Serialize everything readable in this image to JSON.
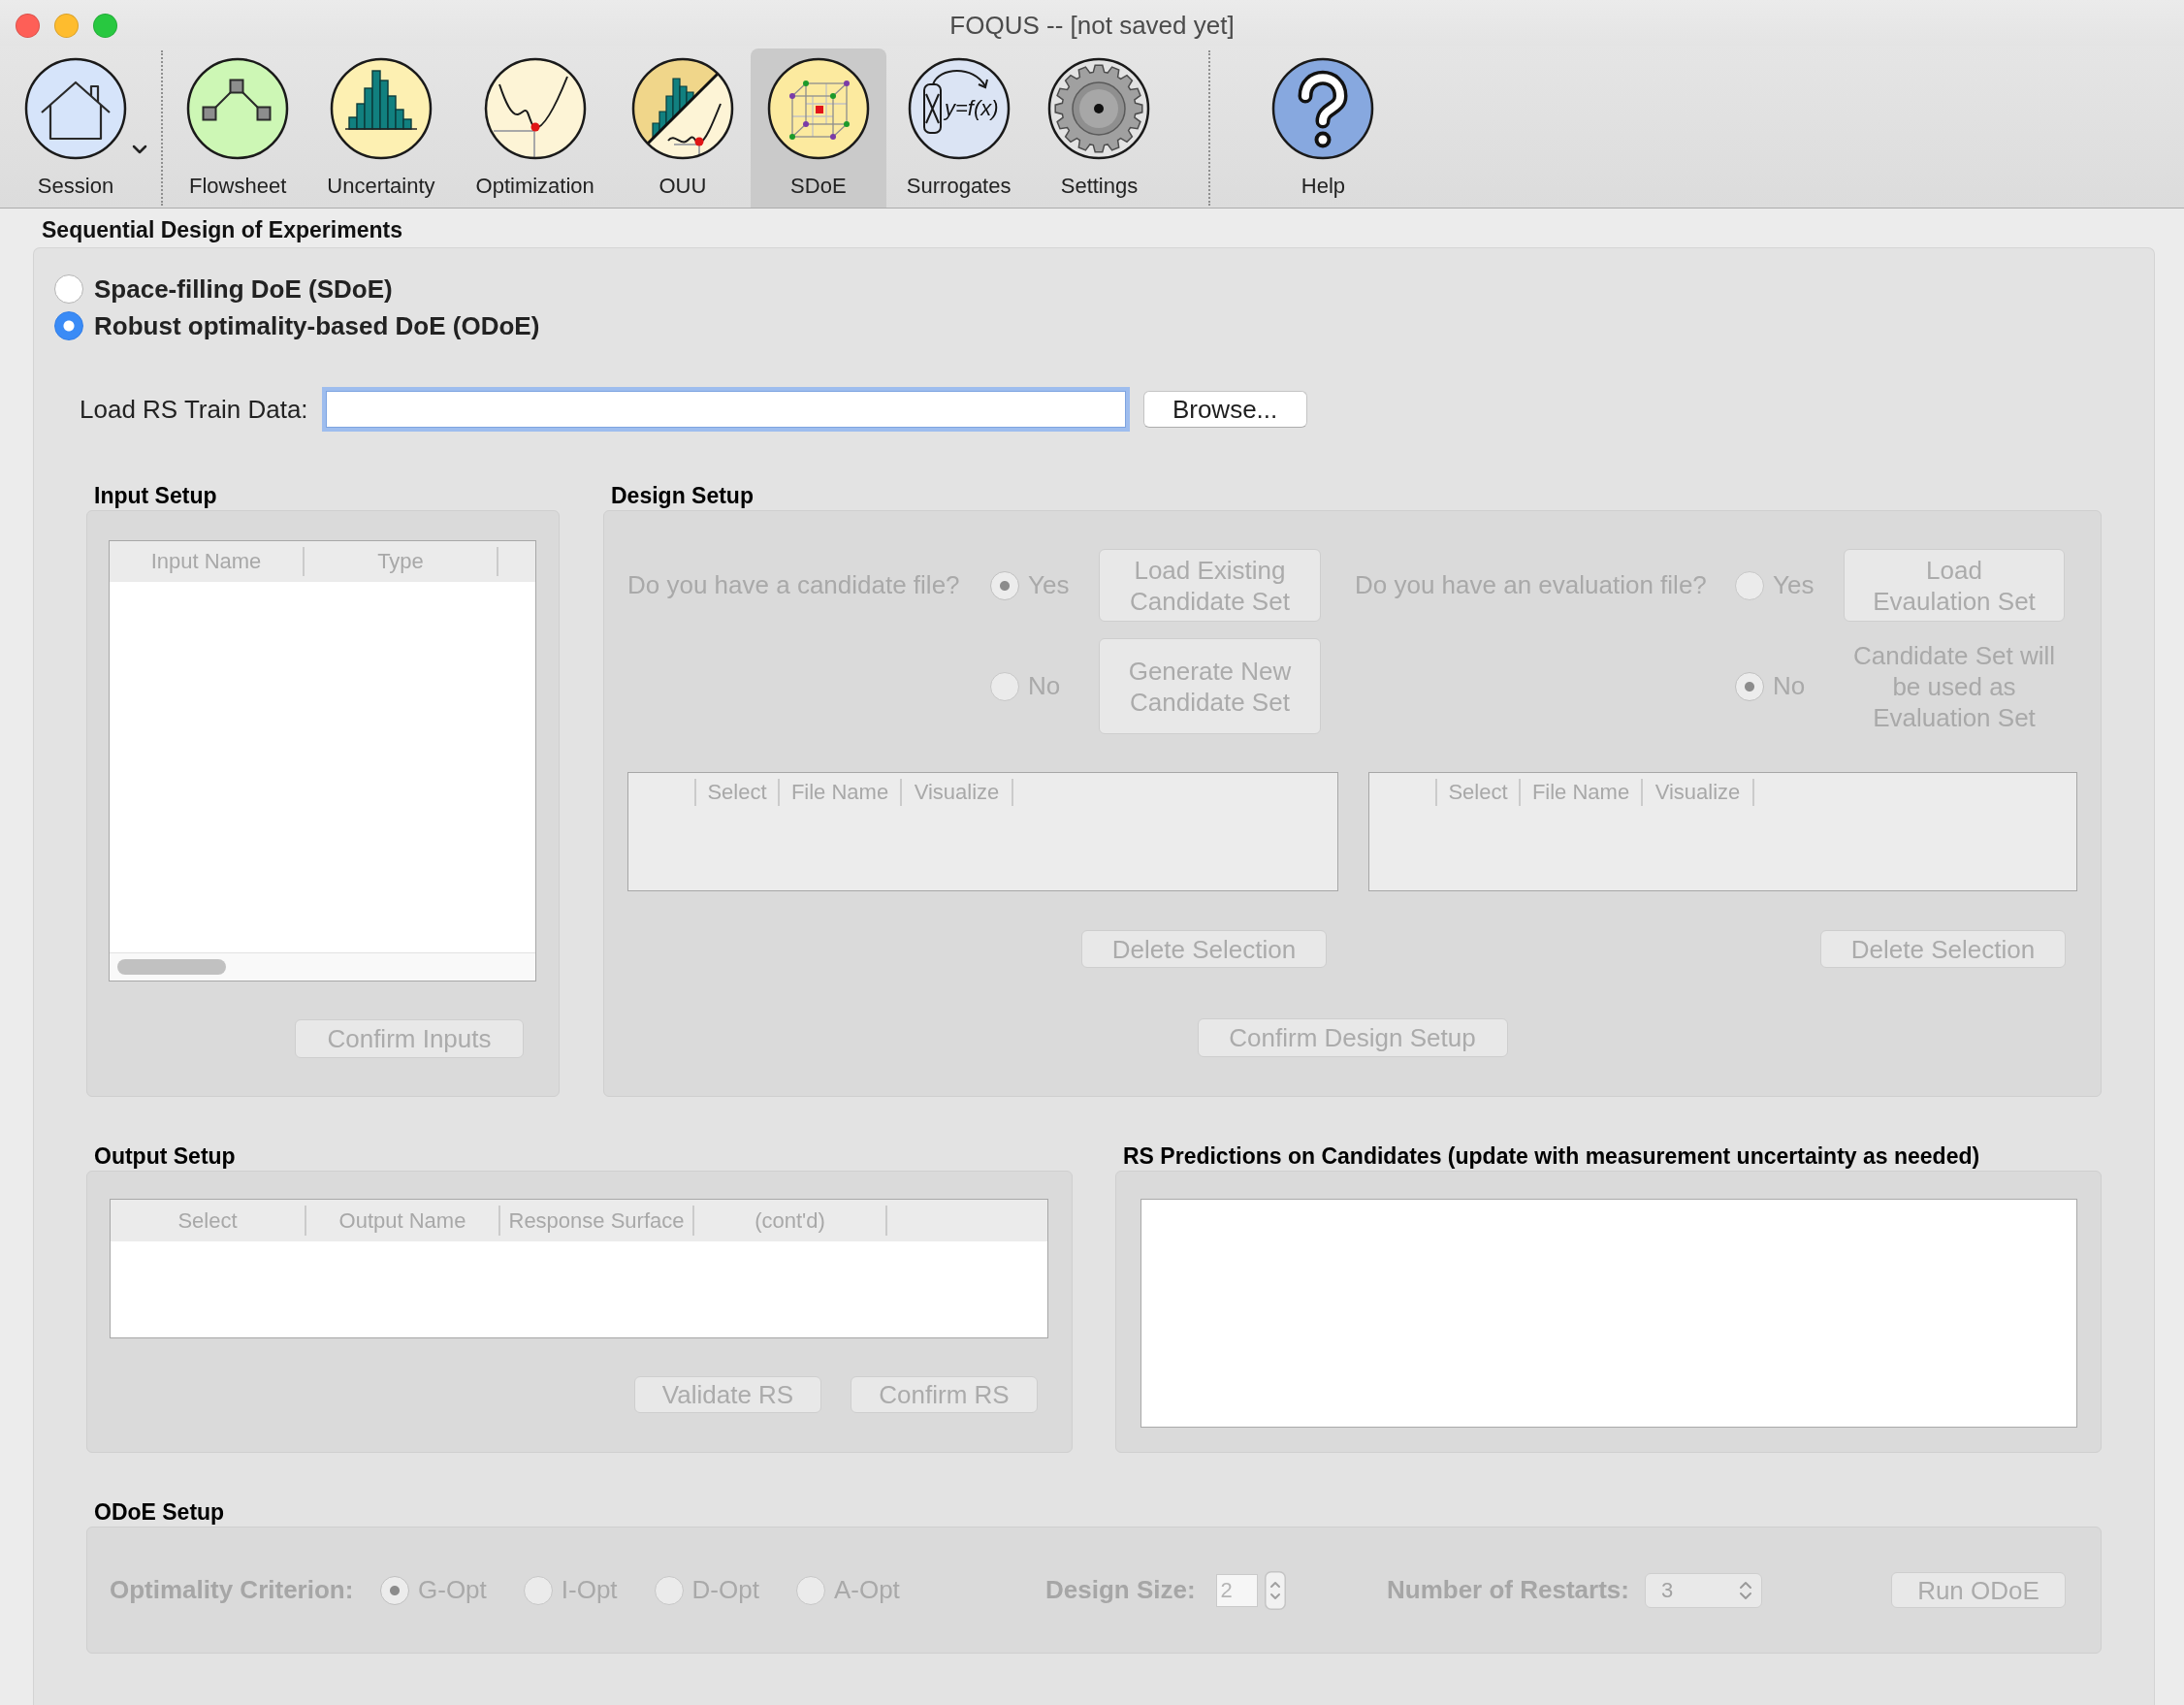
{
  "window": {
    "title": "FOQUS -- [not saved yet]"
  },
  "toolbar": {
    "groups": [
      {
        "items": [
          {
            "label": "Session",
            "selected": false,
            "menu": true
          }
        ]
      },
      {
        "items": [
          {
            "label": "Flowsheet",
            "selected": false,
            "menu": false
          },
          {
            "label": "Uncertainty",
            "selected": false,
            "menu": false
          },
          {
            "label": "Optimization",
            "selected": false,
            "menu": false
          },
          {
            "label": "OUU",
            "selected": false,
            "menu": false
          },
          {
            "label": "SDoE",
            "selected": true,
            "menu": false
          },
          {
            "label": "Surrogates",
            "selected": false,
            "menu": false,
            "icon_text": "y=f(x)"
          },
          {
            "label": "Settings",
            "selected": false,
            "menu": false
          }
        ]
      },
      {
        "items": [
          {
            "label": "Help",
            "selected": false,
            "menu": false
          }
        ]
      }
    ]
  },
  "page": {
    "title": "Sequential Design of Experiments",
    "doe_type": [
      {
        "label": "Space-filling DoE (SDoE)",
        "selected": false
      },
      {
        "label": "Robust optimality-based DoE (ODoE)",
        "selected": true
      }
    ],
    "train_data": {
      "label": "Load RS Train Data:",
      "focused": true,
      "button": "Browse..."
    },
    "input_setup": {
      "title": "Input Setup",
      "disabled": true,
      "columns": [
        "Input Name",
        "Type"
      ],
      "button": "Confirm Inputs"
    },
    "design_setup": {
      "title": "Design Setup",
      "disabled": true,
      "candidate": {
        "question": "Do you have a candidate file?",
        "options": [
          {
            "label": "Yes",
            "selected": true
          },
          {
            "label": "No",
            "selected": false
          }
        ],
        "buttons": [
          "Load Existing Candidate Set",
          "Generate New Candidate Set"
        ],
        "columns": [
          "Select",
          "File Name",
          "Visualize"
        ],
        "delete_button": "Delete Selection"
      },
      "evaluation": {
        "question": "Do you have an evaluation file?",
        "options": [
          {
            "label": "Yes",
            "selected": false
          },
          {
            "label": "No",
            "selected": true
          }
        ],
        "button": "Load Evaulation Set",
        "note": "Candidate Set will be used as Evaluation Set",
        "columns": [
          "Select",
          "File Name",
          "Visualize"
        ],
        "delete_button": "Delete Selection"
      },
      "confirm_button": "Confirm Design Setup"
    },
    "output_setup": {
      "title": "Output Setup",
      "disabled": true,
      "columns": [
        "Select",
        "Output Name",
        "Response Surface",
        "(cont'd)"
      ],
      "buttons": [
        "Validate RS",
        "Confirm RS"
      ]
    },
    "rs_predictions": {
      "title": "RS Predictions on Candidates (update with measurement uncertainty as needed)"
    },
    "odoe_setup": {
      "title": "ODoE Setup",
      "disabled": true,
      "criterion": {
        "label": "Optimality Criterion:",
        "options": [
          {
            "label": "G-Opt",
            "selected": true
          },
          {
            "label": "I-Opt",
            "selected": false
          },
          {
            "label": "D-Opt",
            "selected": false
          },
          {
            "label": "A-Opt",
            "selected": false
          }
        ]
      },
      "design_size": {
        "label": "Design Size:",
        "value": "2"
      },
      "restarts": {
        "label": "Number of Restarts:",
        "value": "3"
      },
      "run_button": "Run ODoE"
    }
  }
}
